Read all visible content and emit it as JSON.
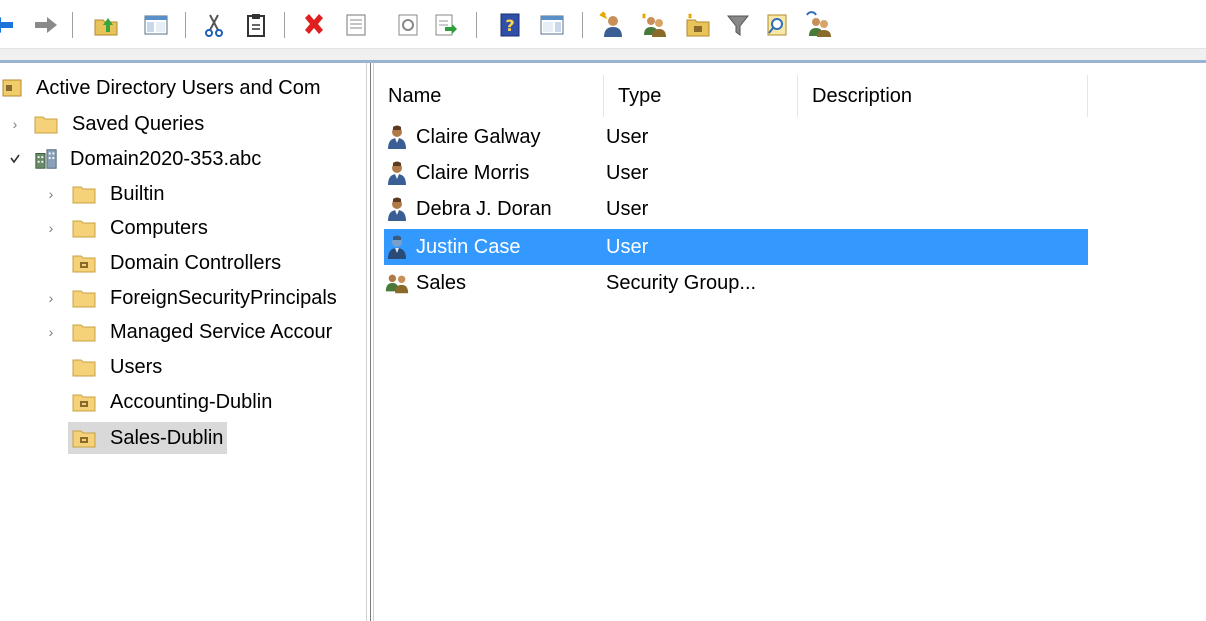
{
  "colors": {
    "selection": "#3399ff",
    "tree_selection": "#d9d9d9",
    "folder": "#f5d27a",
    "separator": "#a0a0a0"
  },
  "toolbar": {
    "buttons": [
      {
        "icon": "back-icon"
      },
      {
        "icon": "forward-icon"
      },
      {
        "icon": "up-folder-icon"
      },
      {
        "icon": "show-hide-console-tree-icon"
      },
      {
        "icon": "cut-icon"
      },
      {
        "icon": "paste-icon"
      },
      {
        "icon": "delete-icon"
      },
      {
        "icon": "properties-icon"
      },
      {
        "icon": "refresh-icon"
      },
      {
        "icon": "export-list-icon"
      },
      {
        "icon": "help-icon"
      },
      {
        "icon": "show-hide-action-pane-icon"
      },
      {
        "icon": "new-user-icon"
      },
      {
        "icon": "new-group-icon"
      },
      {
        "icon": "new-ou-icon"
      },
      {
        "icon": "filter-icon"
      },
      {
        "icon": "find-icon"
      },
      {
        "icon": "add-to-group-icon"
      }
    ]
  },
  "tree": {
    "root": "Active Directory Users and Com",
    "saved_queries": "Saved Queries",
    "domain": "Domain2020-353.abc",
    "items": [
      {
        "label": "Builtin",
        "icon": "folder-icon",
        "expandable": true
      },
      {
        "label": "Computers",
        "icon": "folder-icon",
        "expandable": true
      },
      {
        "label": "Domain Controllers",
        "icon": "ou-folder-icon",
        "expandable": false
      },
      {
        "label": "ForeignSecurityPrincipals",
        "icon": "folder-icon",
        "expandable": true
      },
      {
        "label": "Managed Service Accour",
        "icon": "folder-icon",
        "expandable": true
      },
      {
        "label": "Users",
        "icon": "folder-icon",
        "expandable": false
      },
      {
        "label": "Accounting-Dublin",
        "icon": "ou-folder-icon",
        "expandable": false
      },
      {
        "label": "Sales-Dublin",
        "icon": "ou-folder-icon",
        "expandable": false,
        "selected": true
      }
    ]
  },
  "list": {
    "columns": [
      "Name",
      "Type",
      "Description"
    ],
    "rows": [
      {
        "name": "Claire Galway",
        "type": "User",
        "icon": "user-icon"
      },
      {
        "name": "Claire Morris",
        "type": "User",
        "icon": "user-icon"
      },
      {
        "name": "Debra J. Doran",
        "type": "User",
        "icon": "user-icon"
      },
      {
        "name": "Justin Case",
        "type": "User",
        "icon": "user-icon",
        "selected": true
      },
      {
        "name": "Sales",
        "type": "Security Group...",
        "icon": "group-icon"
      }
    ]
  }
}
